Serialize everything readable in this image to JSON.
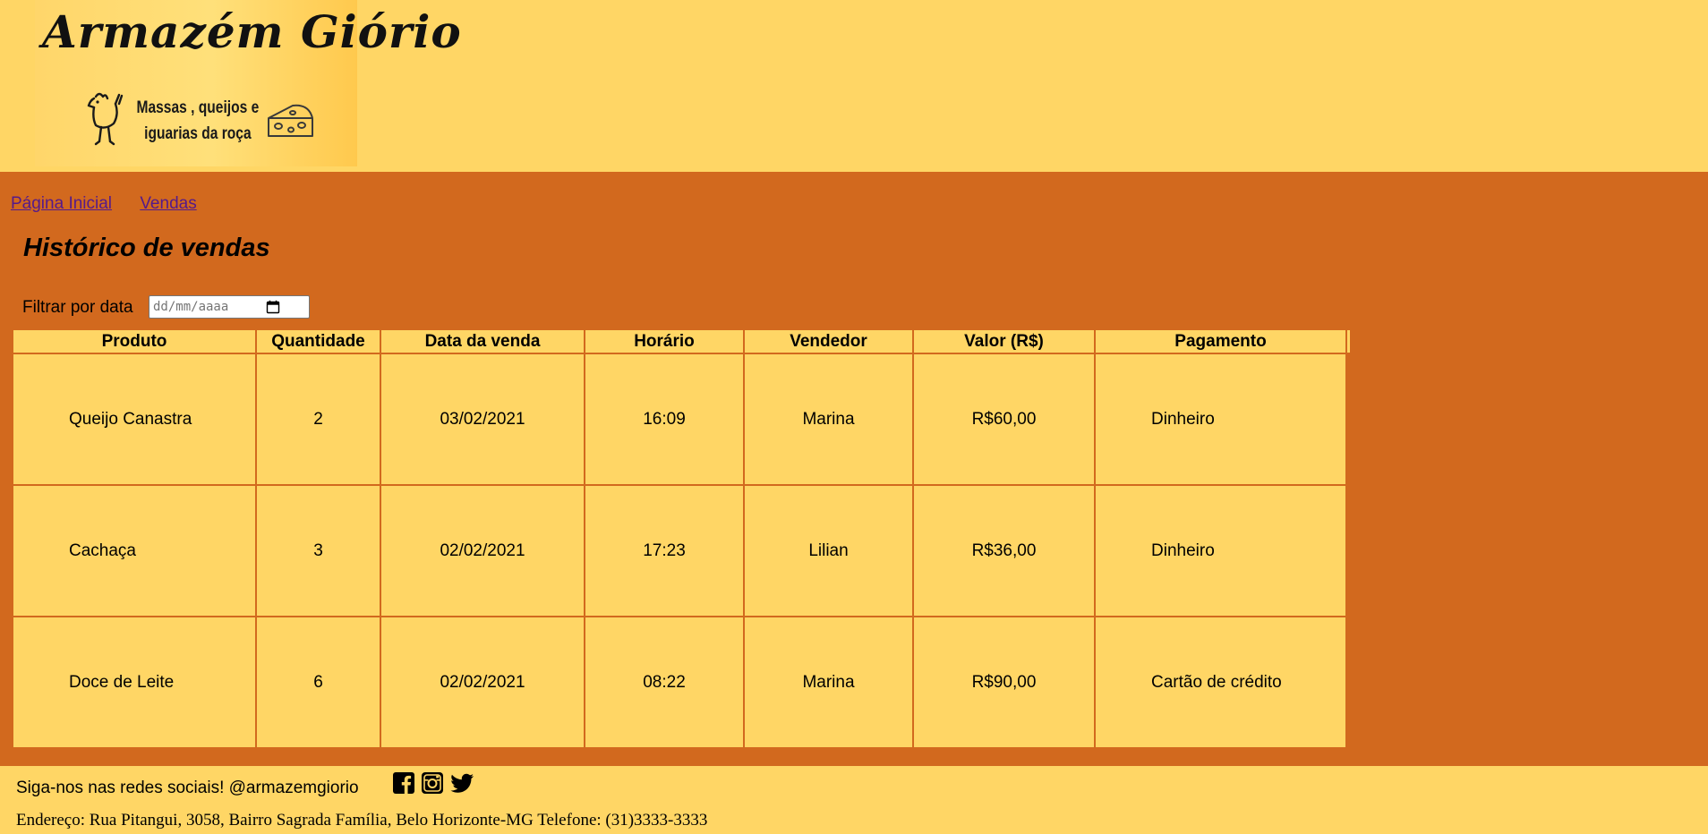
{
  "brand": {
    "name": "Armazém Giório",
    "tagline_line1": "Massas , queijos e",
    "tagline_line2": "iguarias da roça"
  },
  "nav": {
    "items": [
      "Página Inicial",
      "Vendas"
    ]
  },
  "page": {
    "title": "Histórico de vendas"
  },
  "filter": {
    "label": "Filtrar por data",
    "placeholder": "dd/mm/aaaa"
  },
  "table": {
    "headers": [
      "Produto",
      "Quantidade",
      "Data da venda",
      "Horário",
      "Vendedor",
      "Valor (R$)",
      "Pagamento"
    ],
    "rows": [
      [
        "Queijo Canastra",
        "2",
        "03/02/2021",
        "16:09",
        "Marina",
        "R$60,00",
        "Dinheiro"
      ],
      [
        "Cachaça",
        "3",
        "02/02/2021",
        "17:23",
        "Lilian",
        "R$36,00",
        "Dinheiro"
      ],
      [
        "Doce de Leite",
        "6",
        "02/02/2021",
        "08:22",
        "Marina",
        "R$90,00",
        "Cartão de crédito"
      ]
    ]
  },
  "footer": {
    "social_text": "Siga-nos nas redes sociais! @armazemgiorio",
    "social_icons": [
      "facebook-icon",
      "instagram-icon",
      "twitter-icon"
    ],
    "address": "Endereço: Rua Pitangui, 3058, Bairro Sagrada Família, Belo Horizonte-MG Telefone: (31)3333-3333"
  },
  "colors": {
    "background": "#ffd665",
    "main": "#d2691e",
    "link": "#551a8b"
  }
}
